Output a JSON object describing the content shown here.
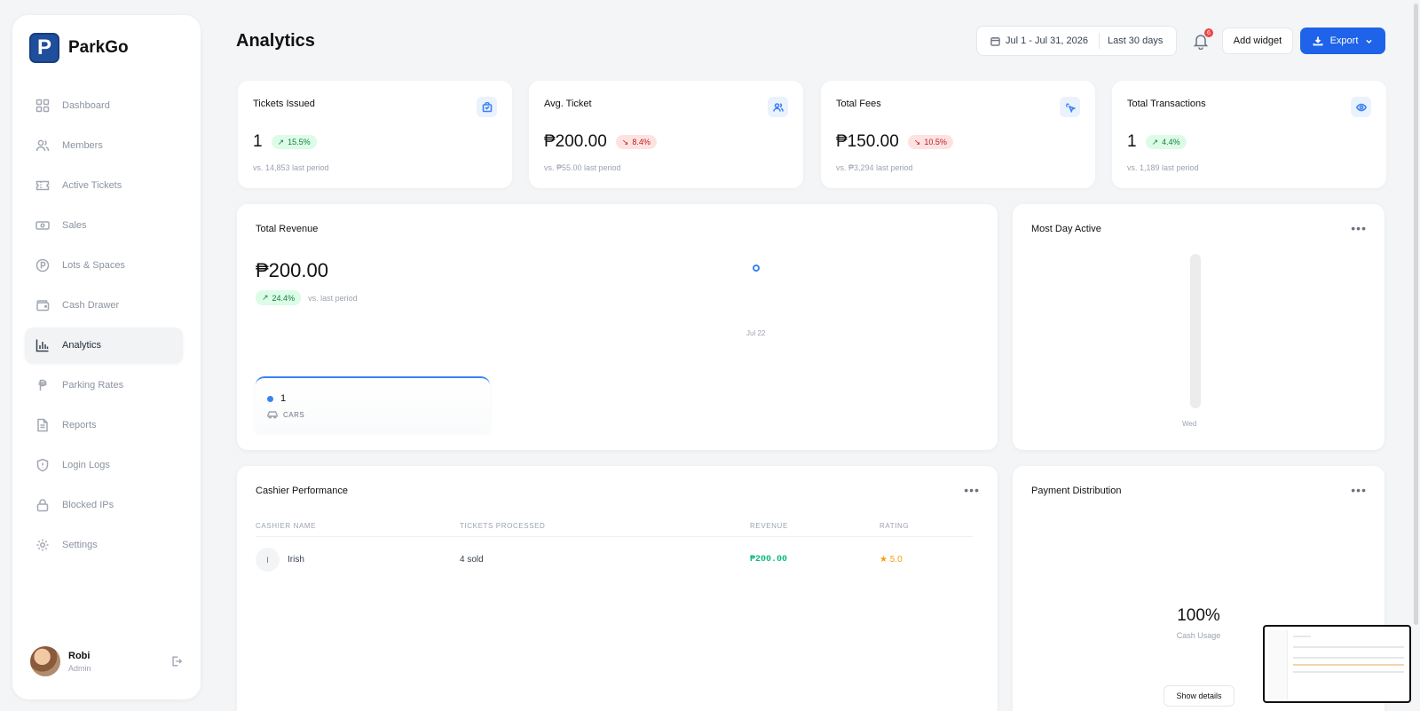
{
  "brand": {
    "letter": "P",
    "name": "ParkGo"
  },
  "nav": [
    {
      "id": "dashboard",
      "label": "Dashboard",
      "icon": "grid-icon"
    },
    {
      "id": "members",
      "label": "Members",
      "icon": "users-icon"
    },
    {
      "id": "active-tickets",
      "label": "Active Tickets",
      "icon": "ticket-icon"
    },
    {
      "id": "sales",
      "label": "Sales",
      "icon": "banknote-icon"
    },
    {
      "id": "lots-spaces",
      "label": "Lots & Spaces",
      "icon": "parking-icon"
    },
    {
      "id": "cash-drawer",
      "label": "Cash Drawer",
      "icon": "wallet-icon"
    },
    {
      "id": "analytics",
      "label": "Analytics",
      "icon": "bar-chart-icon",
      "active": true
    },
    {
      "id": "parking-rates",
      "label": "Parking Rates",
      "icon": "peso-icon"
    },
    {
      "id": "reports",
      "label": "Reports",
      "icon": "file-text-icon"
    },
    {
      "id": "login-logs",
      "label": "Login Logs",
      "icon": "shield-icon"
    },
    {
      "id": "blocked-ips",
      "label": "Blocked IPs",
      "icon": "lock-icon"
    },
    {
      "id": "settings",
      "label": "Settings",
      "icon": "gear-icon"
    }
  ],
  "user": {
    "name": "Robi",
    "role": "Admin"
  },
  "header": {
    "title": "Analytics",
    "date_range": "Jul 1 - Jul 31, 2026",
    "period": "Last 30 days",
    "notifications": "6",
    "add_widget": "Add widget",
    "export": "Export"
  },
  "stats": [
    {
      "title": "Tickets Issued",
      "value": "1",
      "change": "15.5%",
      "direction": "up",
      "sub": "vs. 14,853 last period",
      "icon": "shopping-bag-icon"
    },
    {
      "title": "Avg. Ticket",
      "value": "₱200.00",
      "change": "8.4%",
      "direction": "down",
      "sub": "vs. ₱55.00 last period",
      "icon": "users-icon"
    },
    {
      "title": "Total Fees",
      "value": "₱150.00",
      "change": "10.5%",
      "direction": "down",
      "sub": "vs. ₱3,294 last period",
      "icon": "pointer-click-icon"
    },
    {
      "title": "Total Transactions",
      "value": "1",
      "change": "4.4%",
      "direction": "up",
      "sub": "vs. 1,189 last period",
      "icon": "eye-icon"
    }
  ],
  "revenue": {
    "title": "Total Revenue",
    "value": "₱200.00",
    "change": "24.4%",
    "change_sub": "vs. last period",
    "legend_value": "1",
    "legend_category": "CARS",
    "colors": {
      "series": "#3b82f6"
    }
  },
  "chart_data": [
    {
      "type": "line",
      "title": "Total Revenue",
      "categories": [
        "Jul 22"
      ],
      "series": [
        {
          "values": [
            1
          ]
        }
      ]
    },
    {
      "type": "bar",
      "title": "Most Day Active",
      "categories": [
        "Wed"
      ],
      "values": [
        1
      ]
    }
  ],
  "most_day": {
    "title": "Most Day Active",
    "label": "Wed"
  },
  "cashier": {
    "title": "Cashier Performance",
    "columns": [
      "CASHIER NAME",
      "TICKETS PROCESSED",
      "REVENUE",
      "RATING"
    ],
    "rows": [
      {
        "initial": "I",
        "name": "Irish",
        "tickets": "4 sold",
        "revenue": "₱200.00",
        "rating": "★ 5.0"
      }
    ]
  },
  "payment": {
    "title": "Payment Distribution",
    "value": "100%",
    "label": "Cash Usage",
    "button": "Show details"
  },
  "accent": "#1e63e9"
}
